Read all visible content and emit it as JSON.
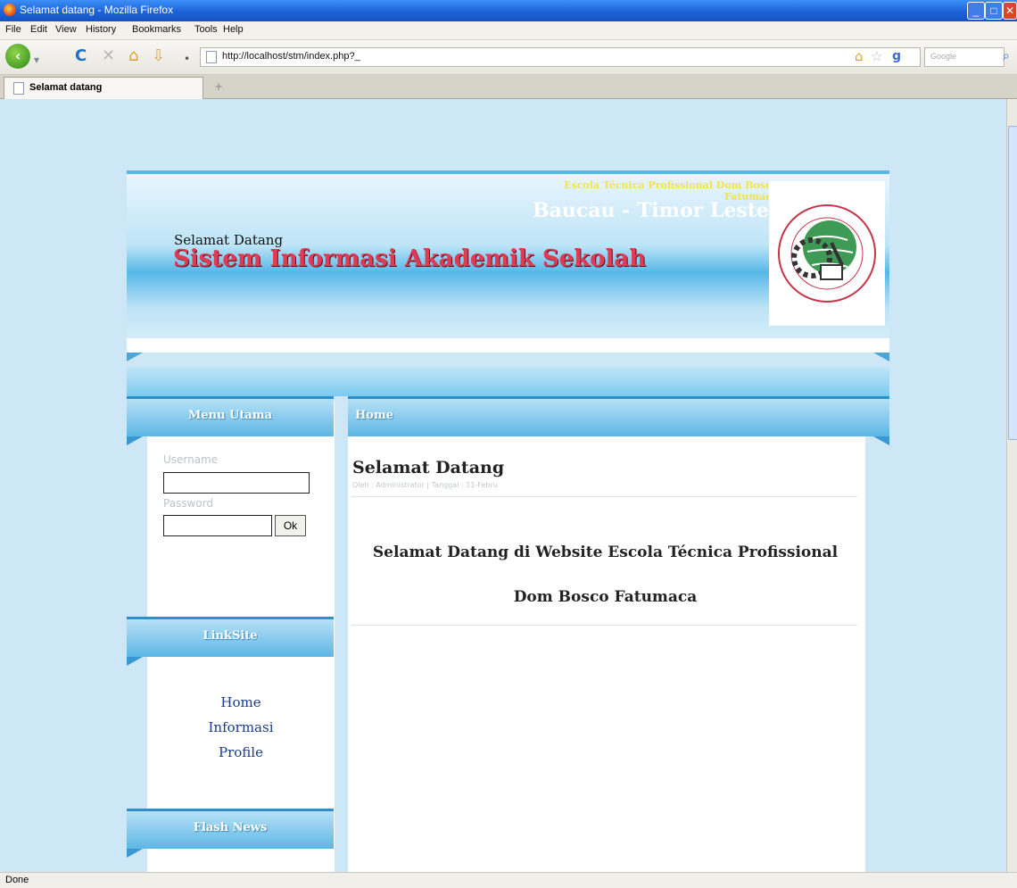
{
  "browser": {
    "window_title": "Selamat datang - Mozilla Firefox",
    "menu": [
      "File",
      "Edit",
      "View",
      "History",
      "Bookmarks",
      "Tools",
      "Help"
    ],
    "url": "http://localhost/stm/index.php?_",
    "search_placeholder": "Google",
    "tab_title": "Selamat datang",
    "new_tab": "+",
    "status": "Done"
  },
  "header": {
    "school": "Escola Técnica Profissional Dom Bosco Fatumaca",
    "place": "Baucau - Timor Leste",
    "welcome": "Selamat Datang",
    "title": "Sistem Informasi Akademik Sekolah"
  },
  "sidebar": {
    "menu_title": "Menu Utama",
    "username_label": "Username",
    "password_label": "Password",
    "ok_label": "Ok",
    "links_title": "LinkSite",
    "links": [
      "Home",
      "Informasi",
      "Profile"
    ],
    "flash_title": "Flash News"
  },
  "main": {
    "section_title": "Home",
    "article_title": "Selamat Datang",
    "article_meta": "Oleh : Administrator | Tanggal : 11-Febru",
    "body_line1": "Selamat Datang di Website Escola Técnica Profissional",
    "body_line2": "Dom Bosco Fatumaca"
  }
}
